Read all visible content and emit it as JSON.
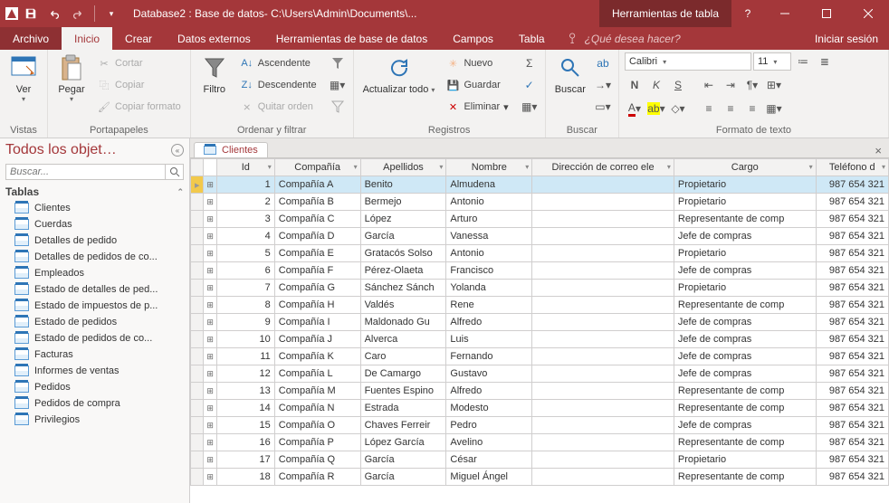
{
  "titlebar": {
    "title": "Database2 : Base de datos- C:\\Users\\Admin\\Documents\\...",
    "context_title": "Herramientas de tabla"
  },
  "tabs": {
    "file": "Archivo",
    "home": "Inicio",
    "create": "Crear",
    "external": "Datos externos",
    "dbtools": "Herramientas de base de datos",
    "fields": "Campos",
    "table": "Tabla",
    "tell_me": "¿Qué desea hacer?",
    "signin": "Iniciar sesión"
  },
  "ribbon": {
    "views": {
      "group": "Vistas",
      "ver": "Ver"
    },
    "clipboard": {
      "group": "Portapapeles",
      "paste": "Pegar",
      "cut": "Cortar",
      "copy": "Copiar",
      "format": "Copiar formato"
    },
    "sort": {
      "group": "Ordenar y filtrar",
      "filter": "Filtro",
      "asc": "Ascendente",
      "desc": "Descendente",
      "clear": "Quitar orden"
    },
    "records": {
      "group": "Registros",
      "refresh": "Actualizar todo",
      "new": "Nuevo",
      "save": "Guardar",
      "delete": "Eliminar"
    },
    "find": {
      "group": "Buscar",
      "find": "Buscar"
    },
    "format": {
      "group": "Formato de texto",
      "font": "Calibri",
      "size": "11"
    }
  },
  "nav": {
    "header": "Todos los objet…",
    "search_placeholder": "Buscar...",
    "group": "Tablas",
    "items": [
      "Clientes",
      "Cuerdas",
      "Detalles de pedido",
      "Detalles de pedidos de co...",
      "Empleados",
      "Estado de detalles de ped...",
      "Estado de impuestos de p...",
      "Estado de pedidos",
      "Estado de pedidos de co...",
      "Facturas",
      "Informes de ventas",
      "Pedidos",
      "Pedidos de compra",
      "Privilegios"
    ]
  },
  "datasheet": {
    "tab": "Clientes",
    "columns": [
      "Id",
      "Compañía",
      "Apellidos",
      "Nombre",
      "Dirección de correo ele",
      "Cargo",
      "Teléfono d"
    ],
    "rows": [
      {
        "id": 1,
        "compania": "Compañía A",
        "apellidos": "Benito",
        "nombre": "Almudena",
        "email": "",
        "cargo": "Propietario",
        "tel": "987 654 321"
      },
      {
        "id": 2,
        "compania": "Compañía B",
        "apellidos": "Bermejo",
        "nombre": "Antonio",
        "email": "",
        "cargo": "Propietario",
        "tel": "987 654 321"
      },
      {
        "id": 3,
        "compania": "Compañía C",
        "apellidos": "López",
        "nombre": "Arturo",
        "email": "",
        "cargo": "Representante de comp",
        "tel": "987 654 321"
      },
      {
        "id": 4,
        "compania": "Compañía D",
        "apellidos": "García",
        "nombre": "Vanessa",
        "email": "",
        "cargo": "Jefe de compras",
        "tel": "987 654 321"
      },
      {
        "id": 5,
        "compania": "Compañía E",
        "apellidos": "Gratacós Solso",
        "nombre": "Antonio",
        "email": "",
        "cargo": "Propietario",
        "tel": "987 654 321"
      },
      {
        "id": 6,
        "compania": "Compañía F",
        "apellidos": "Pérez-Olaeta",
        "nombre": "Francisco",
        "email": "",
        "cargo": "Jefe de compras",
        "tel": "987 654 321"
      },
      {
        "id": 7,
        "compania": "Compañía G",
        "apellidos": "Sánchez Sánch",
        "nombre": "Yolanda",
        "email": "",
        "cargo": "Propietario",
        "tel": "987 654 321"
      },
      {
        "id": 8,
        "compania": "Compañía H",
        "apellidos": "Valdés",
        "nombre": "Rene",
        "email": "",
        "cargo": "Representante de comp",
        "tel": "987 654 321"
      },
      {
        "id": 9,
        "compania": "Compañía I",
        "apellidos": "Maldonado Gu",
        "nombre": "Alfredo",
        "email": "",
        "cargo": "Jefe de compras",
        "tel": "987 654 321"
      },
      {
        "id": 10,
        "compania": "Compañía J",
        "apellidos": "Alverca",
        "nombre": "Luis",
        "email": "",
        "cargo": "Jefe de compras",
        "tel": "987 654 321"
      },
      {
        "id": 11,
        "compania": "Compañía K",
        "apellidos": "Caro",
        "nombre": "Fernando",
        "email": "",
        "cargo": "Jefe de compras",
        "tel": "987 654 321"
      },
      {
        "id": 12,
        "compania": "Compañía L",
        "apellidos": "De Camargo",
        "nombre": "Gustavo",
        "email": "",
        "cargo": "Jefe de compras",
        "tel": "987 654 321"
      },
      {
        "id": 13,
        "compania": "Compañía M",
        "apellidos": "Fuentes Espino",
        "nombre": "Alfredo",
        "email": "",
        "cargo": "Representante de comp",
        "tel": "987 654 321"
      },
      {
        "id": 14,
        "compania": "Compañía N",
        "apellidos": "Estrada",
        "nombre": "Modesto",
        "email": "",
        "cargo": "Representante de comp",
        "tel": "987 654 321"
      },
      {
        "id": 15,
        "compania": "Compañía O",
        "apellidos": "Chaves Ferreir",
        "nombre": "Pedro",
        "email": "",
        "cargo": "Jefe de compras",
        "tel": "987 654 321"
      },
      {
        "id": 16,
        "compania": "Compañía P",
        "apellidos": "López García",
        "nombre": "Avelino",
        "email": "",
        "cargo": "Representante de comp",
        "tel": "987 654 321"
      },
      {
        "id": 17,
        "compania": "Compañía Q",
        "apellidos": "García",
        "nombre": "César",
        "email": "",
        "cargo": "Propietario",
        "tel": "987 654 321"
      },
      {
        "id": 18,
        "compania": "Compañía R",
        "apellidos": "García",
        "nombre": "Miguel Ángel",
        "email": "",
        "cargo": "Representante de comp",
        "tel": "987 654 321"
      }
    ]
  }
}
